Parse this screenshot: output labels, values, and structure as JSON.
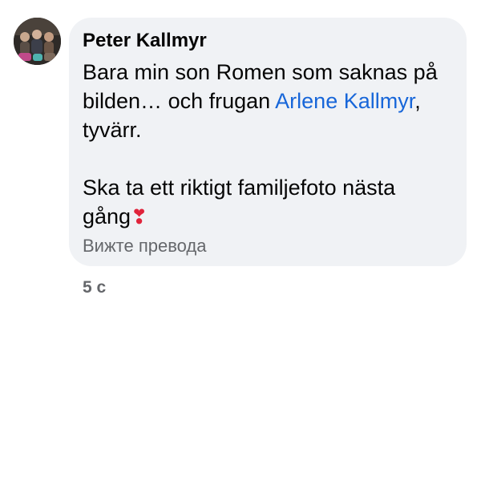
{
  "comment": {
    "author": "Peter Kallmyr",
    "text_line1": "Bara min son Romen som saknas på bilden… och frugan ",
    "mention": "Arlene Kallmyr",
    "text_after_mention": ", tyvärr.",
    "text_para2": "Ska ta ett riktigt familjefoto nästa gång",
    "emoji": "❣",
    "translate_link": "Вижте превода",
    "timestamp": "5 с"
  },
  "colors": {
    "bubble_bg": "#f0f2f5",
    "mention": "#1766d9",
    "secondary_text": "#65676b",
    "heart": "#e0243b"
  },
  "icons": {
    "avatar": "group-photo-avatar"
  }
}
